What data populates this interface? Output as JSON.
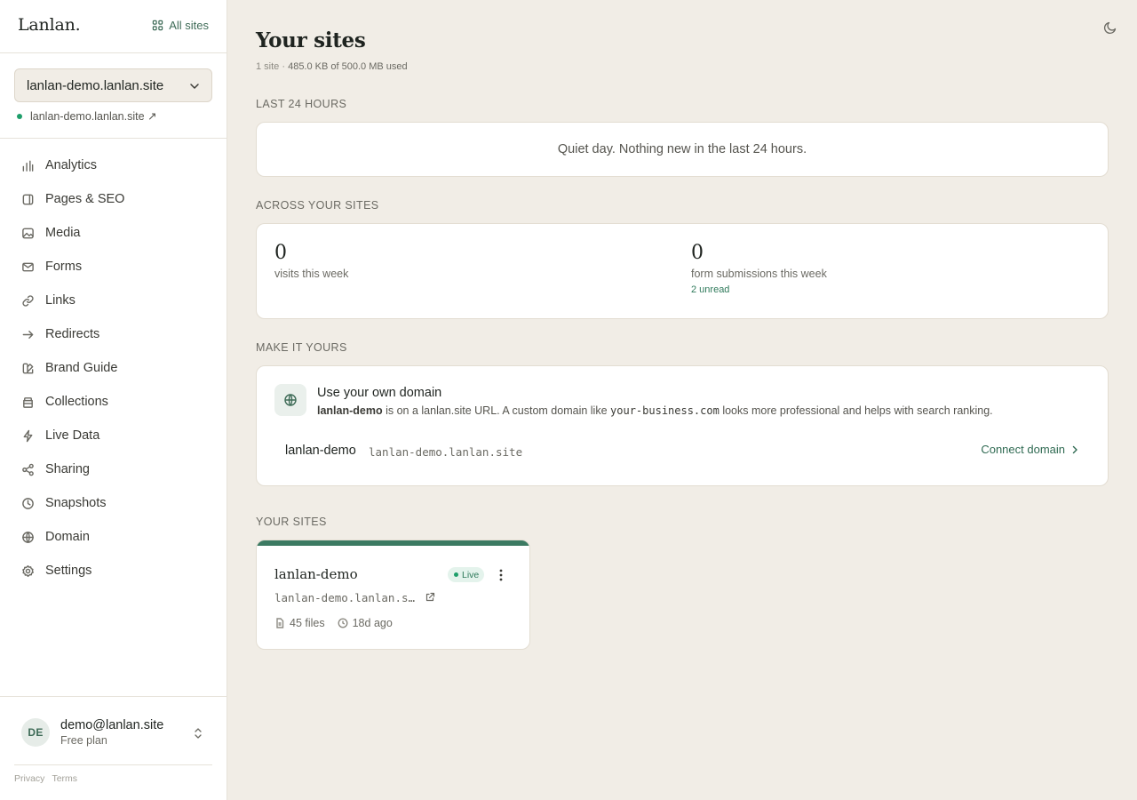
{
  "sidebar": {
    "logo": "Lanlan.",
    "all_sites_label": "All sites",
    "site_select_value": "lanlan-demo.lanlan.site",
    "site_url": "lanlan-demo.lanlan.site ↗",
    "nav": [
      {
        "label": "Analytics",
        "icon": "bar-chart-icon"
      },
      {
        "label": "Pages & SEO",
        "icon": "page-icon"
      },
      {
        "label": "Media",
        "icon": "image-icon"
      },
      {
        "label": "Forms",
        "icon": "mail-icon"
      },
      {
        "label": "Links",
        "icon": "link-icon"
      },
      {
        "label": "Redirects",
        "icon": "arrow-right-icon"
      },
      {
        "label": "Brand Guide",
        "icon": "palette-icon"
      },
      {
        "label": "Collections",
        "icon": "database-icon"
      },
      {
        "label": "Live Data",
        "icon": "bolt-icon"
      },
      {
        "label": "Sharing",
        "icon": "share-icon"
      },
      {
        "label": "Snapshots",
        "icon": "clock-icon"
      },
      {
        "label": "Domain",
        "icon": "globe-icon"
      },
      {
        "label": "Settings",
        "icon": "gear-icon"
      }
    ],
    "user": {
      "initials": "DE",
      "email": "demo@lanlan.site",
      "plan": "Free plan"
    },
    "footer": {
      "privacy": "Privacy",
      "terms": "Terms"
    }
  },
  "main": {
    "title": "Your sites",
    "subtitle_count": "1 site",
    "subtitle_sep": " · ",
    "subtitle_usage": "485.0 KB of 500.0 MB used",
    "last24": {
      "label": "Last 24 hours",
      "empty_text": "Quiet day. Nothing new in the last 24 hours."
    },
    "across": {
      "label": "Across your sites",
      "visits_value": "0",
      "visits_label": "visits this week",
      "forms_value": "0",
      "forms_label": "form submissions this week",
      "unread": "2 unread"
    },
    "make_it_yours": {
      "label": "Make it yours",
      "title": "Use your own domain",
      "desc_site": "lanlan-demo",
      "desc_mid": " is on a lanlan.site URL. A custom domain like ",
      "desc_example": "your-business.com",
      "desc_end": " looks more professional and helps with search ranking.",
      "row_name": "lanlan-demo",
      "row_url": "lanlan-demo.lanlan.site",
      "connect_label": "Connect domain"
    },
    "your_sites": {
      "label": "Your sites",
      "sites": [
        {
          "name": "lanlan-demo",
          "status": "Live",
          "url": "lanlan-demo.lanlan.site",
          "files": "45 files",
          "updated": "18d ago"
        }
      ]
    }
  },
  "colors": {
    "accent": "#3c7a62",
    "live": "#1e9e6a",
    "background": "#f1ede6"
  }
}
